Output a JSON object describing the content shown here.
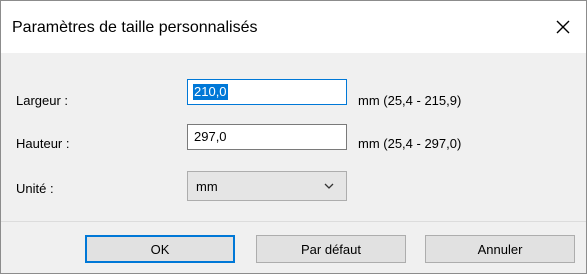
{
  "dialog": {
    "title": "Paramètres de taille personnalisés",
    "close_icon": "close-icon"
  },
  "fields": {
    "width_label": "Largeur :",
    "width_value": "210,0",
    "width_range": "mm (25,4 - 215,9)",
    "height_label": "Hauteur :",
    "height_value": "297,0",
    "height_range": "mm (25,4 - 297,0)",
    "unit_label": "Unité :",
    "unit_value": "mm"
  },
  "buttons": {
    "ok": "OK",
    "default": "Par défaut",
    "cancel": "Annuler"
  },
  "colors": {
    "accent": "#0078d7",
    "dialog_bg": "#f0f0f0"
  }
}
